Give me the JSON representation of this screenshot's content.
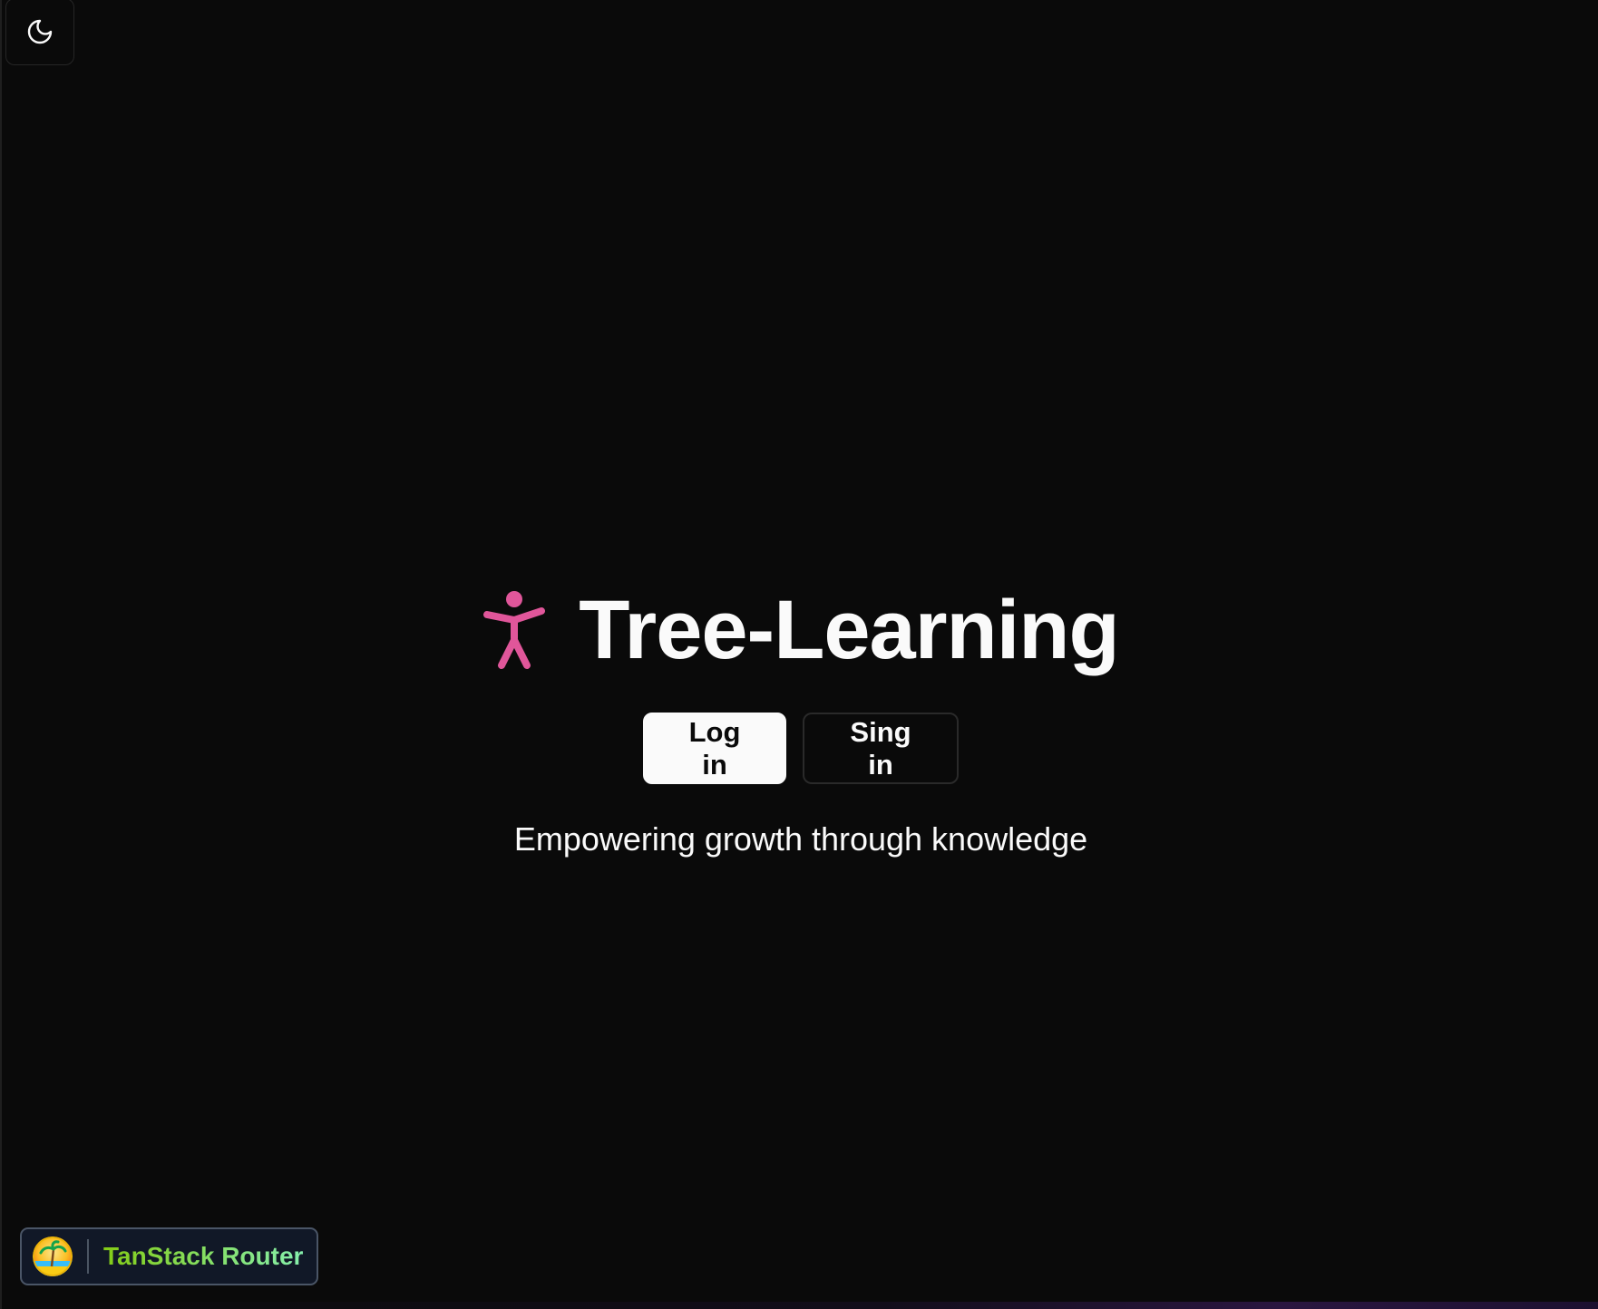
{
  "theme_toggle": {
    "icon": "moon-icon"
  },
  "hero": {
    "logo_icon": "person-standing-icon",
    "logo_color": "#e0569a",
    "title": "Tree-Learning",
    "login_label": "Log in",
    "signin_label": "Sing in",
    "tagline": "Empowering growth through knowledge"
  },
  "devtools": {
    "logo_icon": "tanstack-logo-icon",
    "label": "TanStack Router",
    "label_color": "#86efac"
  },
  "colors": {
    "background": "#0a0a0a",
    "foreground": "#fafafa",
    "border": "#262626"
  }
}
